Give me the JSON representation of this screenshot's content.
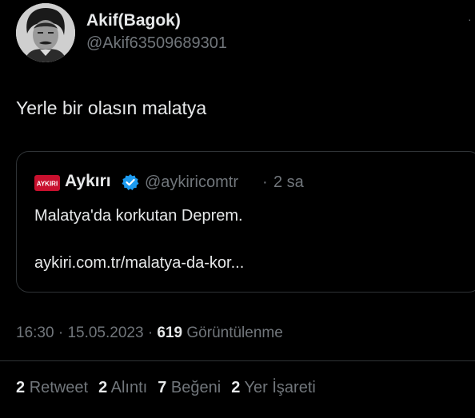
{
  "tweet": {
    "author_name": "Akif(Bagok)",
    "author_handle": "@Akif63509689301",
    "text": "Yerle bir olasın malatya"
  },
  "quote": {
    "logo_text": "AYKIRI",
    "author_name": "Aykırı",
    "author_handle": "@aykiricomtr",
    "separator": "·",
    "time": "2 sa",
    "text": "Malatya'da korkutan Deprem.",
    "link": "aykiri.com.tr/malatya-da-kor..."
  },
  "meta": {
    "time": "16:30",
    "separator": "·",
    "date": "15.05.2023",
    "views_count": "619",
    "views_label": "Görüntülenme"
  },
  "stats": {
    "retweets_count": "2",
    "retweets_label": "Retweet",
    "quotes_count": "2",
    "quotes_label": "Alıntı",
    "likes_count": "7",
    "likes_label": "Beğeni",
    "bookmarks_count": "2",
    "bookmarks_label": "Yer İşareti"
  },
  "colors": {
    "background": "#000000",
    "primary_text": "#e7e9ea",
    "secondary_text": "#71767b",
    "border": "#2f3336",
    "verified_blue": "#1d9bf0",
    "logo_red": "#c8102e"
  }
}
